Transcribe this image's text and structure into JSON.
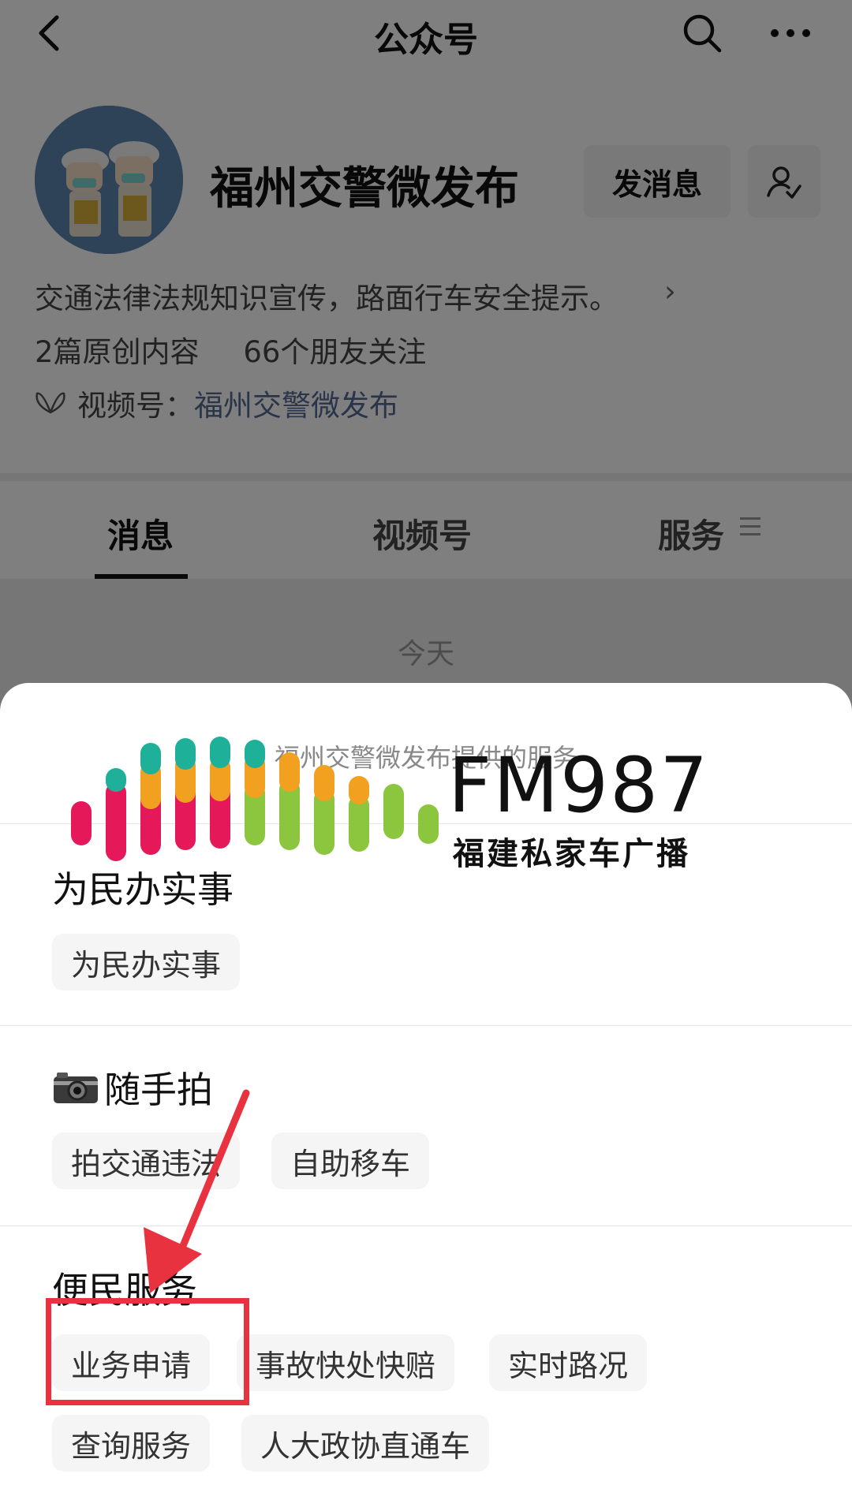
{
  "nav": {
    "title": "公众号",
    "back_icon": "back-chevron-icon",
    "search_icon": "search-icon",
    "more_icon": "more-dots-icon"
  },
  "profile": {
    "name": "福州交警微发布",
    "send_message_label": "发消息",
    "description": "交通法律法规知识宣传，路面行车安全提示。",
    "original_count": "2篇原创内容",
    "friends_following": "66个朋友关注",
    "channel_prefix": "视频号：",
    "channel_name": "福州交警微发布"
  },
  "tabs": [
    {
      "label": "消息",
      "active": true
    },
    {
      "label": "视频号",
      "active": false
    },
    {
      "label": "服务",
      "active": false
    }
  ],
  "chat": {
    "date_label": "今天"
  },
  "sheet": {
    "title": "福州交警微发布提供的服务",
    "sections": [
      {
        "title": "为民办实事",
        "items": [
          "为民办实事"
        ]
      },
      {
        "title": "随手拍",
        "items": [
          "拍交通违法",
          "自助移车"
        ]
      },
      {
        "title": "便民服务",
        "items": [
          "业务申请",
          "事故快处快赔",
          "实时路况",
          "查询服务",
          "人大政协直通车"
        ]
      }
    ]
  },
  "watermark": {
    "brand": "FM987",
    "subtitle": "福建私家车广播"
  },
  "colors": {
    "link": "#576b95",
    "highlight": "#e8323f"
  }
}
